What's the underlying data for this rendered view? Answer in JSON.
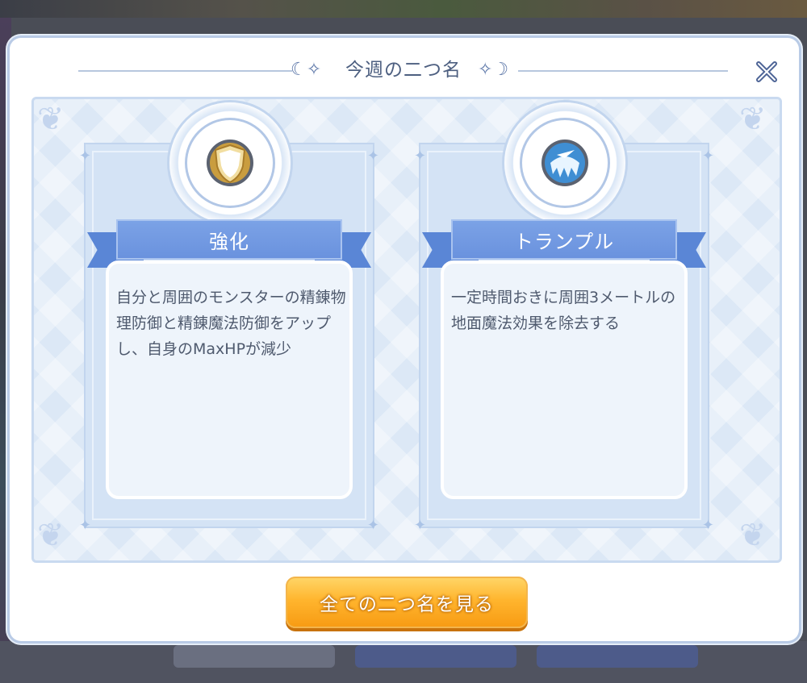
{
  "dialog": {
    "title": "今週の二つ名",
    "close_icon": "close-icon"
  },
  "cards": [
    {
      "name": "強化",
      "icon": "shield-icon",
      "description": "自分と周囲のモンスターの精錬物理防御と精錬魔法防御をアップし、自身のMaxHPが減少"
    },
    {
      "name": "トランプル",
      "icon": "claw-slash-icon",
      "description": "一定時間おきに周囲3メートルの地面魔法効果を除去する"
    }
  ],
  "footer": {
    "view_all_label": "全ての二つ名を見る"
  },
  "colors": {
    "accent_blue": "#6a92de",
    "button_orange": "#f79a12",
    "title_text": "#4d5f80"
  }
}
